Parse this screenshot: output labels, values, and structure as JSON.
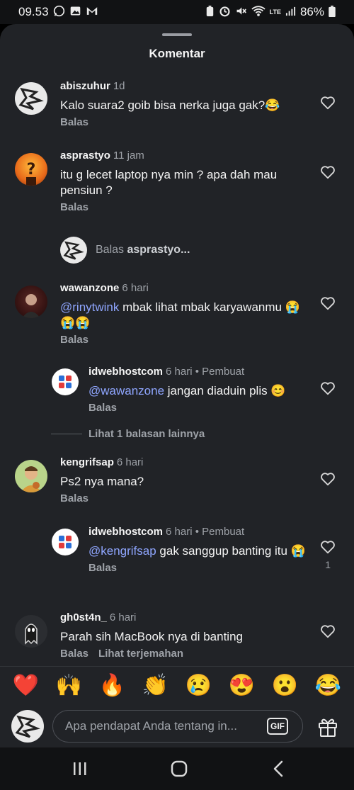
{
  "status_bar": {
    "time": "09.53",
    "battery": "86%",
    "network": "LTE"
  },
  "sheet": {
    "title": "Komentar"
  },
  "comments": [
    {
      "user": "abiszuhur",
      "time": "1d",
      "text": "Kalo suara2 goib bisa nerka juga gak?😂",
      "actions": [
        "Balas"
      ]
    },
    {
      "user": "asprastyo",
      "time": "11 jam",
      "text": "itu g lecet laptop nya min ? apa dah mau pensiun ?",
      "actions": [
        "Balas"
      ]
    },
    {
      "user": "wawanzone",
      "time": "6 hari",
      "mention": "@rinytwink",
      "text": " mbak lihat mbak karyawanmu 😭😭😭",
      "actions": [
        "Balas"
      ]
    },
    {
      "user": "idwebhostcom",
      "time": "6 hari",
      "creator": " • Pembuat",
      "mention": "@wawanzone",
      "text": " jangan diaduin plis 😊",
      "actions": [
        "Balas"
      ]
    },
    {
      "user": "kengrifsap",
      "time": "6 hari",
      "text": "Ps2 nya mana?",
      "actions": [
        "Balas"
      ]
    },
    {
      "user": "idwebhostcom",
      "time": "6 hari",
      "creator": " • Pembuat",
      "mention": "@kengrifsap",
      "text": " gak sanggup banting itu 😭",
      "actions": [
        "Balas"
      ],
      "likes": "1"
    },
    {
      "user": "gh0st4n_",
      "time": "6 hari",
      "text": "Parah sih MacBook nya di banting",
      "actions": [
        "Balas",
        "Lihat terjemahan"
      ]
    }
  ],
  "reply_prompt": {
    "prefix": "Balas ",
    "user": "asprastyo..."
  },
  "more_replies": "Lihat 1 balasan lainnya",
  "emoji_bar": [
    "❤️",
    "🙌",
    "🔥",
    "👏",
    "😢",
    "😍",
    "😮",
    "😂"
  ],
  "composer": {
    "placeholder": "Apa pendapat Anda tentang in...",
    "gif_label": "GIF"
  },
  "icons": {
    "heart": "heart-icon",
    "gift": "gift-icon",
    "nav_recent": "recent-apps-icon",
    "nav_home": "home-icon",
    "nav_back": "back-icon"
  },
  "colors": {
    "sheet_bg": "#212327",
    "mention": "#8fa6ff",
    "muted": "#9ea2a8"
  }
}
